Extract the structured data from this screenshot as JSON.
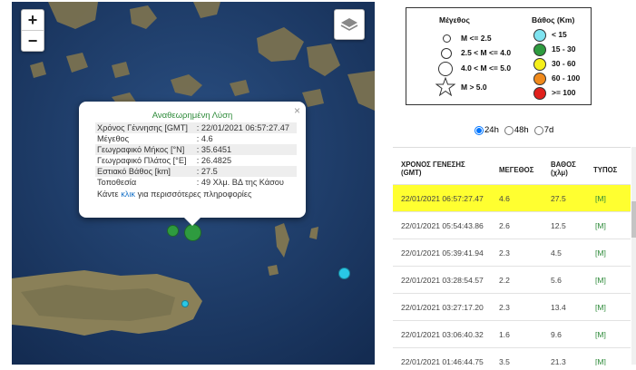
{
  "map": {
    "zoom_in": "+",
    "zoom_out": "−",
    "layers_icon": "layers-icon",
    "popup": {
      "title": "Αναθεωρημένη Λύση",
      "close": "×",
      "rows": [
        {
          "label": "Χρόνος Γέννησης [GMT]",
          "value": ": 22/01/2021 06:57:27.47"
        },
        {
          "label": "Μέγεθος",
          "value": ": 4.6"
        },
        {
          "label": "Γεωγραφικό Μήκος [°N]",
          "value": ": 35.6451"
        },
        {
          "label": "Γεωγραφικό Πλάτος [°E]",
          "value": ": 26.4825"
        },
        {
          "label": "Εστιακό Βάθος [km]",
          "value": ": 27.5"
        },
        {
          "label": "Τοποθεσία",
          "value": ": 49 Χλμ. ΒΔ της Κάσου"
        }
      ],
      "more_prefix": "Κάντε ",
      "more_link": "κλικ",
      "more_suffix": " για περισσότερες πληροφορίες"
    },
    "colors": {
      "green": "#2e9b3f",
      "cyan": "#29c7e6"
    }
  },
  "legend": {
    "magnitude_title": "Μέγεθος",
    "magnitude_items": [
      "M <= 2.5",
      "2.5 < M <= 4.0",
      "4.0 < M <= 5.0",
      "M > 5.0"
    ],
    "depth_title": "Βάθος (Km)",
    "depth_items": [
      {
        "label": "< 15",
        "color": "#7fe3f0"
      },
      {
        "label": "15 - 30",
        "color": "#2e9b3f"
      },
      {
        "label": "30 - 60",
        "color": "#f5ef1a"
      },
      {
        "label": "60 - 100",
        "color": "#f08a1c"
      },
      {
        "label": ">= 100",
        "color": "#e0201c"
      }
    ]
  },
  "periods": {
    "options": [
      "24h",
      "48h",
      "7d"
    ],
    "selected": "24h"
  },
  "table": {
    "headers": {
      "time": "ΧΡΟΝΟΣ ΓΕΝΕΣΗΣ (GMT)",
      "magnitude": "ΜΕΓΕΘΟΣ",
      "depth": "ΒΑΘΟΣ (χλμ)",
      "type": "ΤΥΠΟΣ"
    },
    "rows": [
      {
        "time": "22/01/2021 06:57:27.47",
        "magnitude": "4.6",
        "depth": "27.5",
        "type": "[M]",
        "selected": true
      },
      {
        "time": "22/01/2021 05:54:43.86",
        "magnitude": "2.6",
        "depth": "12.5",
        "type": "[M]"
      },
      {
        "time": "22/01/2021 05:39:41.94",
        "magnitude": "2.3",
        "depth": "4.5",
        "type": "[M]"
      },
      {
        "time": "22/01/2021 03:28:54.57",
        "magnitude": "2.2",
        "depth": "5.6",
        "type": "[M]"
      },
      {
        "time": "22/01/2021 03:27:17.20",
        "magnitude": "2.3",
        "depth": "13.4",
        "type": "[M]"
      },
      {
        "time": "22/01/2021 03:06:40.32",
        "magnitude": "1.6",
        "depth": "9.6",
        "type": "[M]"
      },
      {
        "time": "22/01/2021 01:46:44.75",
        "magnitude": "3.5",
        "depth": "21.3",
        "type": "[M]"
      }
    ]
  }
}
